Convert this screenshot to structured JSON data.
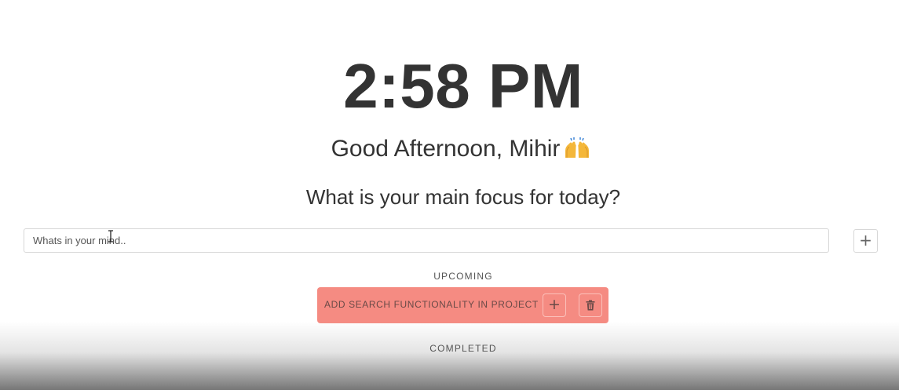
{
  "clock": {
    "time": "2:58 PM"
  },
  "greeting": {
    "text": "Good Afternoon, Mihir",
    "emoji_icon": "raising-hands-icon"
  },
  "focus": {
    "question": "What is your main focus for today?"
  },
  "task_entry": {
    "placeholder": "Whats in your mind..",
    "value": "",
    "add_icon": "plus-icon"
  },
  "sections": {
    "upcoming_label": "UPCOMING",
    "completed_label": "COMPLETED"
  },
  "upcoming_tasks": [
    {
      "text": "ADD SEARCH FUNCTIONALITY IN PROJECT",
      "complete_icon": "plus-icon",
      "delete_icon": "trash-icon"
    }
  ],
  "colors": {
    "text": "#333333",
    "task_card": "#f58b82",
    "task_text": "#6a4a47",
    "border": "#d7d7d7"
  }
}
